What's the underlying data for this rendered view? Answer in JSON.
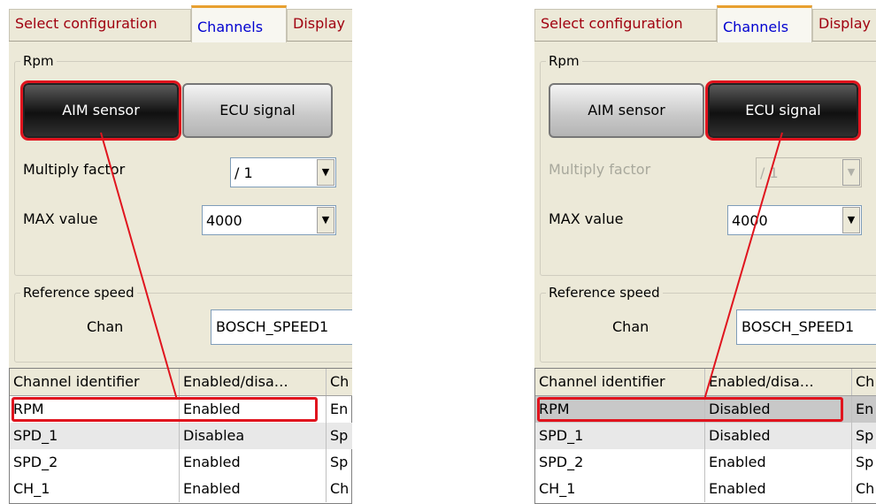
{
  "tabs": [
    "Select configuration",
    "Channels",
    "Display"
  ],
  "left": {
    "group_title": "Rpm",
    "btn_aim": "AIM sensor",
    "btn_ecu": "ECU signal",
    "multiply_label": "Multiply factor",
    "multiply_value": "/ 1",
    "max_label": "MAX value",
    "max_value": "4000",
    "ref_title": "Reference speed",
    "chan_label": "Chan",
    "chan_value": "BOSCH_SPEED1",
    "headers": [
      "Channel identifier",
      "Enabled/disa…",
      "Ch"
    ],
    "rows": [
      [
        "RPM",
        "Enabled",
        "En"
      ],
      [
        "SPD_1",
        "Disablea",
        "Sp"
      ],
      [
        "SPD_2",
        "Enabled",
        "Sp"
      ],
      [
        "CH_1",
        "Enabled",
        "Ch"
      ]
    ]
  },
  "right": {
    "group_title": "Rpm",
    "btn_aim": "AIM sensor",
    "btn_ecu": "ECU signal",
    "multiply_label": "Multiply factor",
    "multiply_value": "/ 1",
    "max_label": "MAX value",
    "max_value": "4000",
    "ref_title": "Reference speed",
    "chan_label": "Chan",
    "chan_value": "BOSCH_SPEED1",
    "headers": [
      "Channel identifier",
      "Enabled/disa…",
      "Ch"
    ],
    "rows": [
      [
        "RPM",
        "Disabled",
        "En"
      ],
      [
        "SPD_1",
        "Disabled",
        "Sp"
      ],
      [
        "SPD_2",
        "Enabled",
        "Sp"
      ],
      [
        "CH_1",
        "Enabled",
        "Ch"
      ]
    ]
  },
  "colors": {
    "highlight": "#e0141e",
    "tab_text": "#a0000f",
    "tab_active_text": "#0000d0"
  }
}
